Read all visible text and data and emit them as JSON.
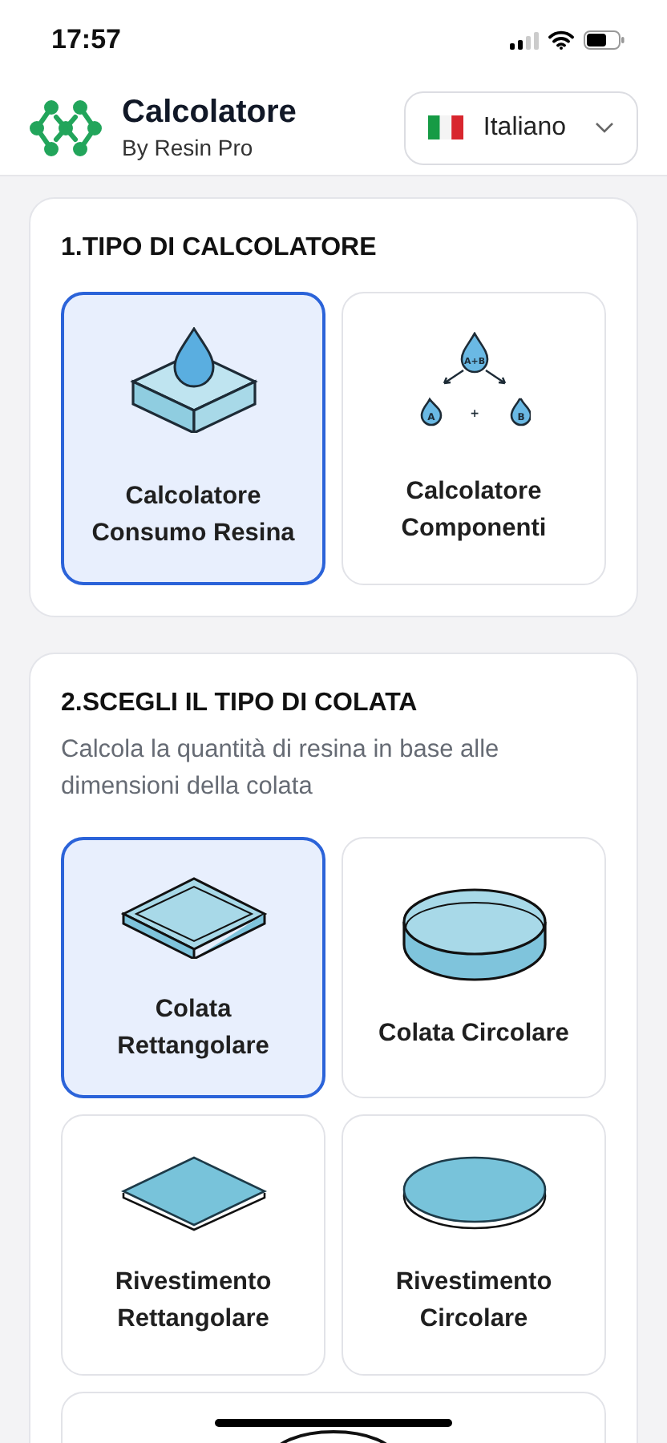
{
  "status_bar": {
    "time": "17:57"
  },
  "header": {
    "title": "Calcolatore",
    "subtitle": "By Resin Pro",
    "language": {
      "label": "Italiano"
    }
  },
  "calculator_type": {
    "title": "1.TIPO DI CALCOLATORE",
    "options": [
      {
        "kind": "resin-box",
        "label": "Calcolatore Consumo Resina",
        "selected": true
      },
      {
        "kind": "ab-split",
        "label": "Calcolatore Componenti",
        "selected": false,
        "drop_labels": [
          "A+B",
          "A",
          "+",
          "B"
        ]
      }
    ]
  },
  "casting_type": {
    "title": "2.SCEGLI IL TIPO DI COLATA",
    "description": "Calcola la quantità di resina in base alle dimensioni della colata",
    "options": [
      {
        "kind": "rect-pour",
        "label": "Colata Rettangolare",
        "selected": true
      },
      {
        "kind": "circle-pour",
        "label": "Colata Circolare",
        "selected": false
      },
      {
        "kind": "rect-coat",
        "label": "Rivestimento Rettangolare",
        "selected": false
      },
      {
        "kind": "circle-coat",
        "label": "Rivestimento Circolare",
        "selected": false
      },
      {
        "kind": "partial",
        "selected": false
      }
    ]
  }
}
